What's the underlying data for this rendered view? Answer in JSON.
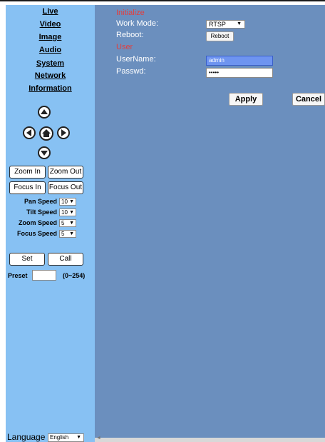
{
  "nav": {
    "items": [
      "Live",
      "Video",
      "Image",
      "Audio",
      "System",
      "Network",
      "Information"
    ]
  },
  "ptz": {
    "up_icon": "arrow-up-icon",
    "left_icon": "arrow-left-icon",
    "home_icon": "home-icon",
    "right_icon": "arrow-right-icon",
    "down_icon": "arrow-down-icon",
    "zoom_in": "Zoom In",
    "zoom_out": "Zoom Out",
    "focus_in": "Focus In",
    "focus_out": "Focus Out",
    "speeds": [
      {
        "label": "Pan Speed",
        "value": "10"
      },
      {
        "label": "Tilt Speed",
        "value": "10"
      },
      {
        "label": "Zoom Speed",
        "value": "5"
      },
      {
        "label": "Focus Speed",
        "value": "5"
      }
    ],
    "set_label": "Set",
    "call_label": "Call",
    "preset_label": "Preset",
    "preset_value": "",
    "preset_range": "(0~254)"
  },
  "language": {
    "label": "Language",
    "value": "English"
  },
  "form": {
    "initialize_title": "Initialize",
    "work_mode_label": "Work Mode:",
    "work_mode_value": "RTSP",
    "reboot_label": "Reboot:",
    "reboot_button": "Reboot",
    "user_title": "User",
    "username_label": "UserName:",
    "username_value": "admin",
    "passwd_label": "Passwd:",
    "passwd_value": "•••••",
    "apply_label": "Apply",
    "cancel_label": "Cancel"
  },
  "colors": {
    "sidebar_bg": "#87c1f3",
    "main_bg": "#6b8fbe",
    "section_heading": "#e04040",
    "selected_input": "#6e94f0"
  }
}
